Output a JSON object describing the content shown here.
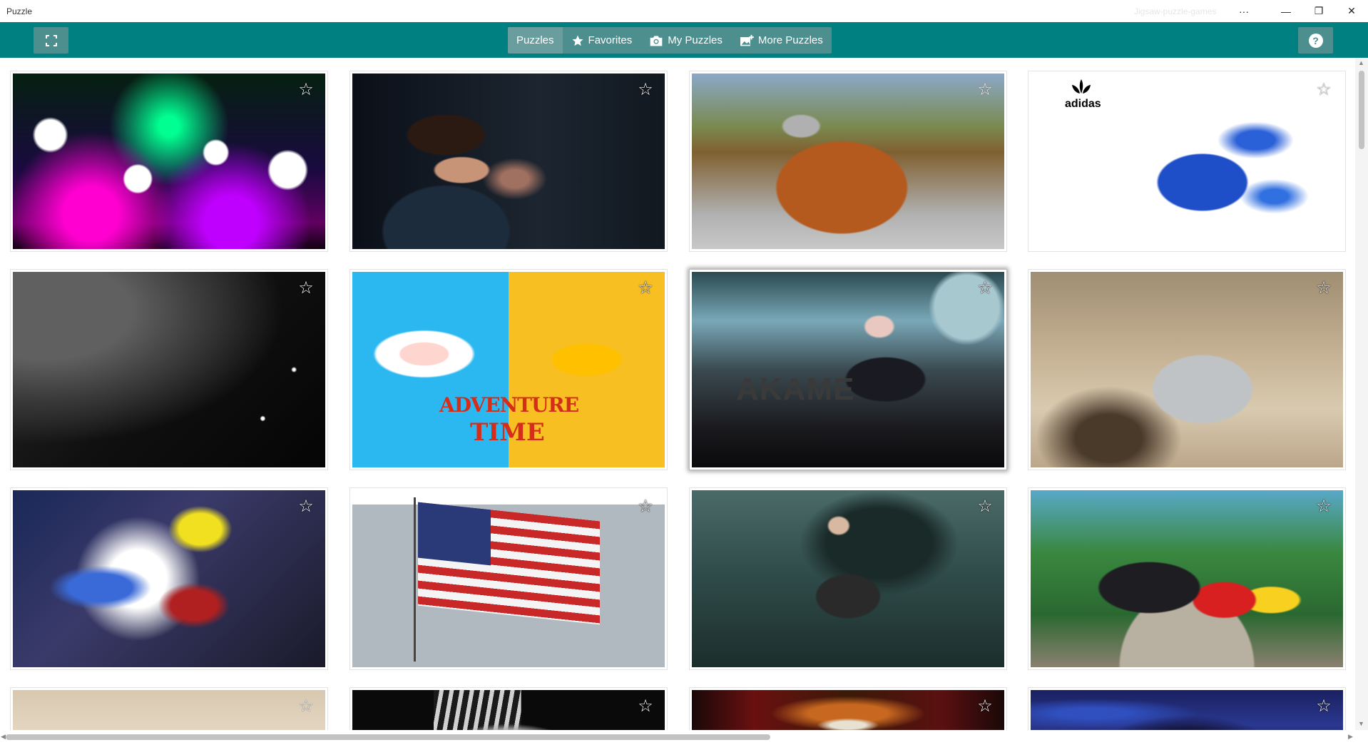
{
  "window": {
    "title": "Puzzle",
    "ghost_text": "Jigsaw-puzzle-games",
    "controls": {
      "more": "···",
      "minimize": "—",
      "restore": "❐",
      "close": "✕"
    }
  },
  "toolbar": {
    "tabs": [
      {
        "label": "Puzzles",
        "icon": "none",
        "active": true
      },
      {
        "label": "Favorites",
        "icon": "star-icon",
        "active": false
      },
      {
        "label": "My Puzzles",
        "icon": "camera-icon",
        "active": false
      },
      {
        "label": "More Puzzles",
        "icon": "add-image-icon",
        "active": false
      }
    ],
    "help": "?"
  },
  "colors": {
    "toolbar": "#008080",
    "toolbar_button": "#4d8f8f",
    "active_tab": "#6a9e9e"
  },
  "tile_labels": {
    "adidas": "adidas",
    "adventure": "ADVENTURE",
    "time": "TIME",
    "akame": "AKAME"
  },
  "star_glyph": "☆",
  "puzzles": [
    {
      "id": "neon-spheres",
      "favorite": false,
      "selected": false
    },
    {
      "id": "headphones-portrait",
      "favorite": false,
      "selected": false
    },
    {
      "id": "orange-muscle-car",
      "favorite": false,
      "selected": false
    },
    {
      "id": "adidas-shoe",
      "favorite": false,
      "selected": false
    },
    {
      "id": "death-star",
      "favorite": false,
      "selected": false
    },
    {
      "id": "adventure-time",
      "favorite": false,
      "selected": false
    },
    {
      "id": "akame-anime",
      "favorite": false,
      "selected": true
    },
    {
      "id": "silver-sports-car",
      "favorite": false,
      "selected": false
    },
    {
      "id": "hero-anime",
      "favorite": false,
      "selected": false
    },
    {
      "id": "american-flag",
      "favorite": false,
      "selected": false
    },
    {
      "id": "fantasy-woman",
      "favorite": false,
      "selected": false
    },
    {
      "id": "angry-birds",
      "favorite": false,
      "selected": false
    },
    {
      "id": "beige-partial",
      "favorite": false,
      "selected": false
    },
    {
      "id": "tiger-partial",
      "favorite": false,
      "selected": false
    },
    {
      "id": "anime-fire-partial",
      "favorite": false,
      "selected": false
    },
    {
      "id": "blue-anime-partial",
      "favorite": false,
      "selected": false
    }
  ]
}
